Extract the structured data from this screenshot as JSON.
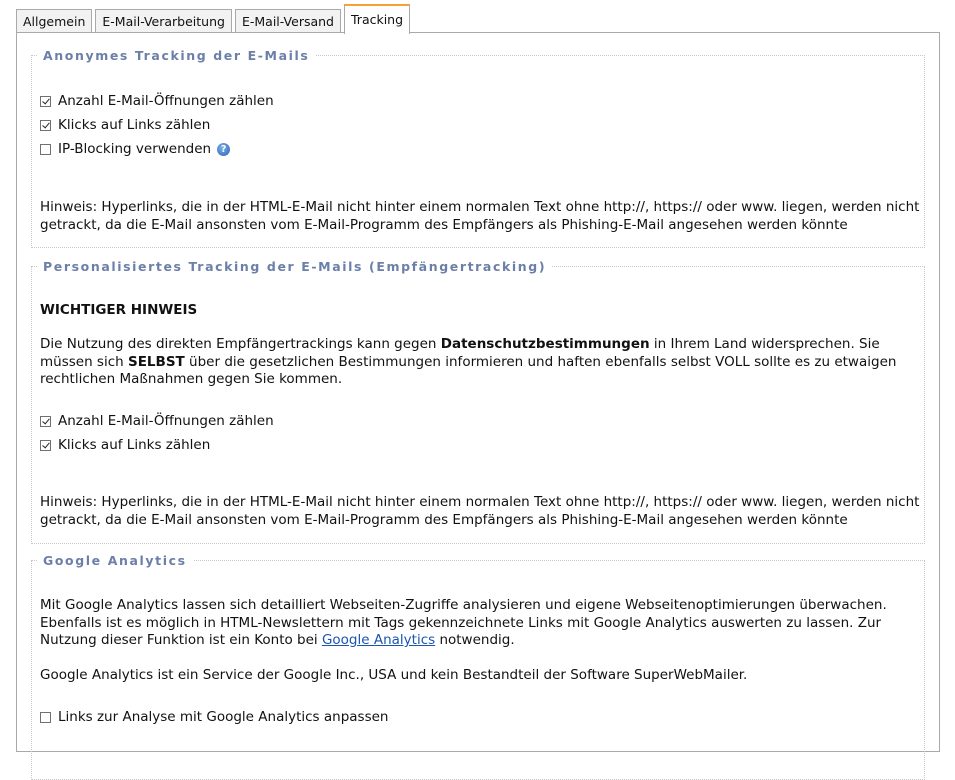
{
  "tabs": [
    {
      "label": "Allgemein",
      "active": false
    },
    {
      "label": "E-Mail-Verarbeitung",
      "active": false
    },
    {
      "label": "E-Mail-Versand",
      "active": false
    },
    {
      "label": "Tracking",
      "active": true
    }
  ],
  "anon": {
    "legend": "Anonymes Tracking der E-Mails",
    "opens_label": "Anzahl E-Mail-Öffnungen zählen",
    "opens_checked": true,
    "clicks_label": "Klicks auf Links zählen",
    "clicks_checked": true,
    "ipblock_label": "IP-Blocking verwenden",
    "ipblock_checked": false,
    "hint": "Hinweis: Hyperlinks, die in der HTML-E-Mail nicht hinter einem normalen Text ohne http://, https:// oder www. liegen, werden nicht getrackt, da die E-Mail ansonsten vom E-Mail-Programm des Empfängers als Phishing-E-Mail angesehen werden könnte"
  },
  "personal": {
    "legend": "Personalisiertes Tracking der E-Mails (Empfängertracking)",
    "important_title": "WICHTIGER HINWEIS",
    "notice_part1": "Die Nutzung des direkten Empfängertrackings kann gegen ",
    "notice_bold1": "Datenschutzbestimmungen",
    "notice_part2": " in Ihrem Land widersprechen. Sie müssen sich ",
    "notice_bold2": "SELBST",
    "notice_part3": " über die gesetzlichen Bestimmungen informieren und haften ebenfalls selbst VOLL sollte es zu etwaigen rechtlichen Maßnahmen gegen Sie kommen.",
    "opens_label": "Anzahl E-Mail-Öffnungen zählen",
    "opens_checked": true,
    "clicks_label": "Klicks auf Links zählen",
    "clicks_checked": true,
    "hint": "Hinweis: Hyperlinks, die in der HTML-E-Mail nicht hinter einem normalen Text ohne http://, https:// oder www. liegen, werden nicht getrackt, da die E-Mail ansonsten vom E-Mail-Programm des Empfängers als Phishing-E-Mail angesehen werden könnte"
  },
  "ga": {
    "legend": "Google Analytics",
    "desc_part1": "Mit Google Analytics lassen sich detailliert Webseiten-Zugriffe analysieren und eigene Webseitenoptimierungen überwachen. Ebenfalls ist es möglich in HTML-Newslettern mit Tags gekennzeichnete Links mit Google Analytics auswerten zu lassen. Zur Nutzung dieser Funktion ist ein Konto bei ",
    "desc_link": "Google Analytics",
    "desc_part2": " notwendig.",
    "service_text": "Google Analytics ist ein Service der Google Inc., USA und kein Bestandteil der Software SuperWebMailer.",
    "adjust_label": "Links zur Analyse mit Google Analytics anpassen",
    "adjust_checked": false
  },
  "icons": {
    "help": "help-question-icon",
    "checkbox": "checkbox-icon"
  },
  "colors": {
    "legend": "#6b7fa8",
    "active_tab_accent": "#f4a236",
    "link": "#1a54b5"
  }
}
